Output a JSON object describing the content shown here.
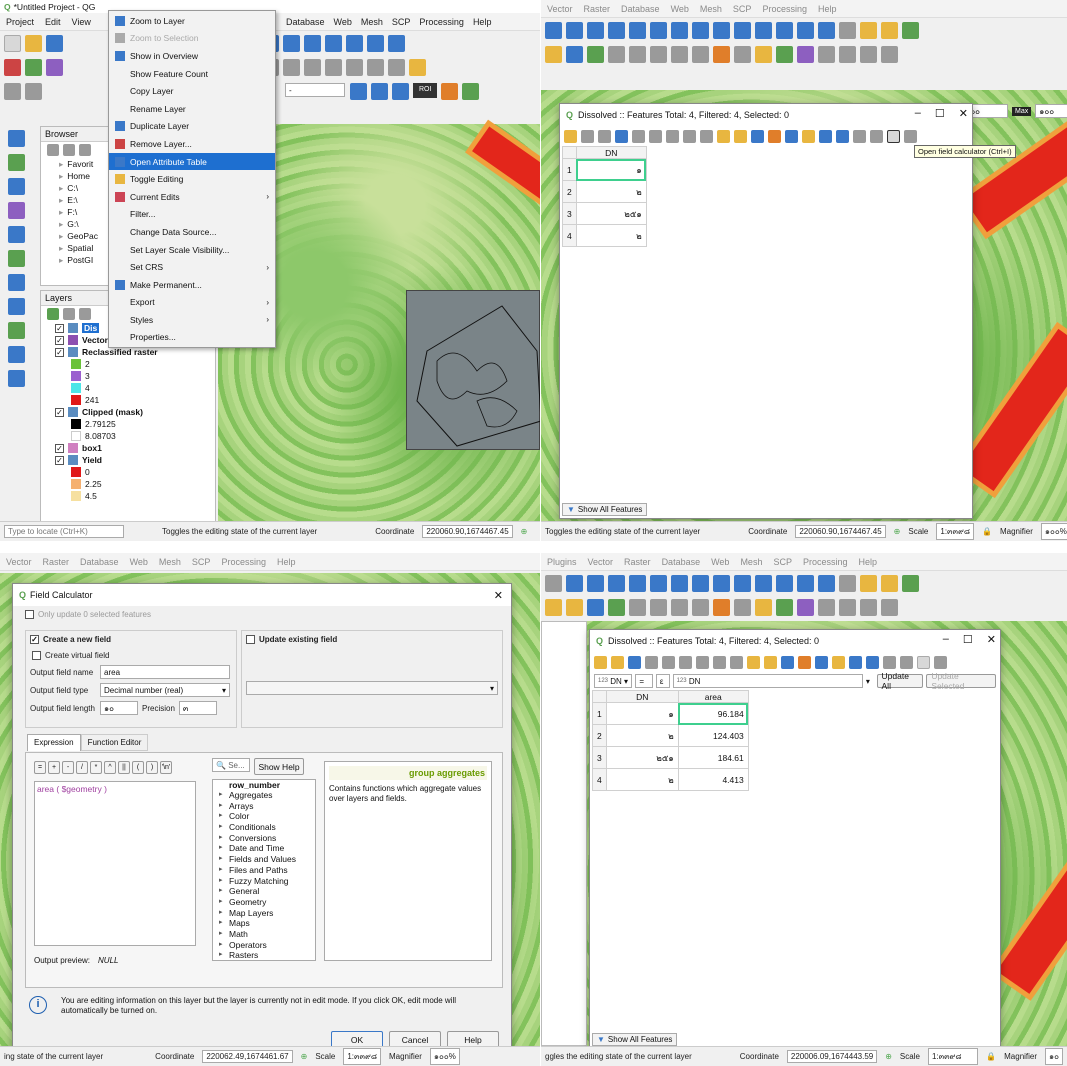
{
  "q1": {
    "title_text": "*Untitled Project - QG",
    "menus": [
      "Project",
      "Edit",
      "View"
    ],
    "right_menus": [
      "Database",
      "Web",
      "Mesh",
      "SCP",
      "Processing",
      "Help"
    ],
    "browser": {
      "title": "Browser",
      "items": [
        "Favorit",
        "Home",
        "C:\\",
        "E:\\",
        "F:\\",
        "G:\\",
        "GeoPac",
        "Spatial",
        "PostGI"
      ]
    },
    "layers": {
      "title": "Layers",
      "items": [
        {
          "label": "Dis",
          "bold": true,
          "selected": true
        },
        {
          "label": "Vectorized",
          "bold": true,
          "color": "#8d4fb0"
        },
        {
          "label": "Reclassified raster",
          "bold": true
        },
        {
          "label": "2",
          "swatch": "#6ac23a"
        },
        {
          "label": "3",
          "swatch": "#9b5fcf"
        },
        {
          "label": "4",
          "swatch": "#4de6e8"
        },
        {
          "label": "241",
          "swatch": "#e01818"
        },
        {
          "label": "Clipped (mask)",
          "bold": true
        },
        {
          "label": "2.79125",
          "swatch": "#000000"
        },
        {
          "label": "8.08703",
          "swatch": null
        },
        {
          "label": "box1",
          "bold": true,
          "color": "#d080c0"
        },
        {
          "label": "Yield",
          "bold": true
        },
        {
          "label": "0",
          "swatch": "#e01818"
        },
        {
          "label": "2.25",
          "swatch": "#f5b070"
        },
        {
          "label": "4.5",
          "swatch": "#f6e0a0"
        }
      ]
    },
    "context_menu": [
      {
        "label": "Zoom to Layer",
        "state": "normal"
      },
      {
        "label": "Zoom to Selection",
        "state": "disabled"
      },
      {
        "label": "Show in Overview",
        "state": "normal"
      },
      {
        "label": "Show Feature Count",
        "state": "normal"
      },
      {
        "label": "Copy Layer",
        "state": "normal"
      },
      {
        "label": "Rename Layer",
        "state": "normal"
      },
      {
        "label": "Duplicate Layer",
        "state": "normal"
      },
      {
        "label": "Remove Layer...",
        "state": "normal"
      },
      {
        "label": "Open Attribute Table",
        "state": "highlighted"
      },
      {
        "label": "Toggle Editing",
        "state": "normal"
      },
      {
        "label": "Current Edits",
        "state": "normal",
        "submenu": true
      },
      {
        "label": "Filter...",
        "state": "normal"
      },
      {
        "label": "Change Data Source...",
        "state": "normal"
      },
      {
        "label": "Set Layer Scale Visibility...",
        "state": "normal"
      },
      {
        "label": "Set CRS",
        "state": "normal",
        "submenu": true
      },
      {
        "label": "Make Permanent...",
        "state": "normal"
      },
      {
        "label": "Export",
        "state": "normal",
        "submenu": true
      },
      {
        "label": "Styles",
        "state": "normal",
        "submenu": true
      },
      {
        "label": "Properties...",
        "state": "normal"
      }
    ],
    "locate_placeholder": "Type to locate (Ctrl+K)",
    "status_message": "Toggles the editing state of the current layer",
    "coordinate_label": "Coordinate",
    "coordinate_value": "220060.90,1674467.45",
    "roi_label": "ROI"
  },
  "q2": {
    "menus": [
      "Vector",
      "Raster",
      "Database",
      "Web",
      "Mesh",
      "SCP",
      "Processing",
      "Help"
    ],
    "window_title": "Dissolved :: Features Total: 4, Filtered: 4, Selected: 0",
    "column": "DN",
    "rows": [
      "๑",
      "๒",
      "๒๕๑",
      "๒"
    ],
    "row_nums": [
      "1",
      "2",
      "3",
      "4"
    ],
    "tooltip": "Open field calculator (Ctrl+I)",
    "show_all": "Show All Features",
    "status_message": "Toggles the editing state of the current layer",
    "coordinate_label": "Coordinate",
    "coordinate_value": "220060.90,1674467.45",
    "scale_label": "Scale",
    "scale_value": "1:๓๓๙๘",
    "magnifier_label": "Magnifier",
    "magnifier_value": "๑๐๐%",
    "min_value": "๖๐",
    "max_label": "Max",
    "max_value": "๑๐๐"
  },
  "q3": {
    "menus": [
      "Vector",
      "Raster",
      "Database",
      "Web",
      "Mesh",
      "SCP",
      "Processing",
      "Help"
    ],
    "window_title": "Field Calculator",
    "only_update": "Only update 0 selected features",
    "create_new": "Create a new field",
    "update_existing": "Update existing field",
    "create_virtual": "Create virtual field",
    "output_name_label": "Output field name",
    "output_name_value": "area",
    "output_type_label": "Output field type",
    "output_type_value": "Decimal number (real)",
    "output_length_label": "Output field length",
    "output_length_value": "๑๐",
    "precision_label": "Precision",
    "precision_value": "๓",
    "tabs": [
      "Expression",
      "Function Editor"
    ],
    "operators": [
      "=",
      "+",
      "-",
      "/",
      "*",
      "^",
      "||",
      "(",
      ")",
      "'\\n'"
    ],
    "expression": "area ( $geometry )",
    "search_placeholder": "Se...",
    "show_help": "Show Help",
    "functions": [
      "row_number",
      "Aggregates",
      "Arrays",
      "Color",
      "Conditionals",
      "Conversions",
      "Date and Time",
      "Fields and Values",
      "Files and Paths",
      "Fuzzy Matching",
      "General",
      "Geometry",
      "Map Layers",
      "Maps",
      "Math",
      "Operators",
      "Rasters"
    ],
    "help_title": "group aggregates",
    "help_text": "Contains functions which aggregate values over layers and fields.",
    "output_preview_label": "Output preview:",
    "output_preview_value": "NULL",
    "info_text": "You are editing information on this layer but the layer is currently not in edit mode. If you click OK, edit mode will automatically be turned on.",
    "ok": "OK",
    "cancel": "Cancel",
    "help": "Help",
    "status_left": "ing state of the current layer",
    "coordinate_label": "Coordinate",
    "coordinate_value": "220062.49,1674461.67",
    "scale_label": "Scale",
    "scale_value": "1:๓๓๙๘",
    "magnifier_label": "Magnifier",
    "magnifier_value": "๑๐๐%"
  },
  "q4": {
    "menus": [
      "Plugins",
      "Vector",
      "Raster",
      "Database",
      "Web",
      "Mesh",
      "SCP",
      "Processing",
      "Help"
    ],
    "window_title": "Dissolved :: Features Total: 4, Filtered: 4, Selected: 0",
    "field_select": "DN",
    "eq": "=",
    "epsilon": "ε",
    "expr_field": "DN",
    "update_all": "Update All",
    "update_selected": "Update Selected",
    "columns": [
      "DN",
      "area"
    ],
    "rows": [
      {
        "num": "1",
        "dn": "๑",
        "area": "96.184"
      },
      {
        "num": "2",
        "dn": "๒",
        "area": "124.403"
      },
      {
        "num": "3",
        "dn": "๒๕๑",
        "area": "184.61"
      },
      {
        "num": "4",
        "dn": "๒",
        "area": "4.413"
      }
    ],
    "show_all": "Show All Features",
    "status_message": "ggles the editing state of the current layer",
    "coordinate_label": "Coordinate",
    "coordinate_value": "220006.09,1674443.59",
    "scale_label": "Scale",
    "scale_value": "1:๓๓๙๘",
    "magnifier_label": "Magnifier",
    "magnifier_value": "๑๐"
  }
}
